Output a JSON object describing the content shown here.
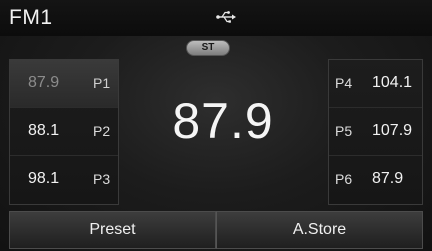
{
  "header": {
    "band": "FM1",
    "usb_icon": "usb-icon"
  },
  "stereo_badge": "ST",
  "main": {
    "frequency": "87.9"
  },
  "presets_left": [
    {
      "frequency": "87.9",
      "label": "P1",
      "selected": true
    },
    {
      "frequency": "88.1",
      "label": "P2",
      "selected": false
    },
    {
      "frequency": "98.1",
      "label": "P3",
      "selected": false
    }
  ],
  "presets_right": [
    {
      "label": "P4",
      "frequency": "104.1"
    },
    {
      "label": "P5",
      "frequency": "107.9"
    },
    {
      "label": "P6",
      "frequency": "87.9"
    }
  ],
  "bottom_buttons": {
    "preset": "Preset",
    "auto_store": "A.Store"
  }
}
